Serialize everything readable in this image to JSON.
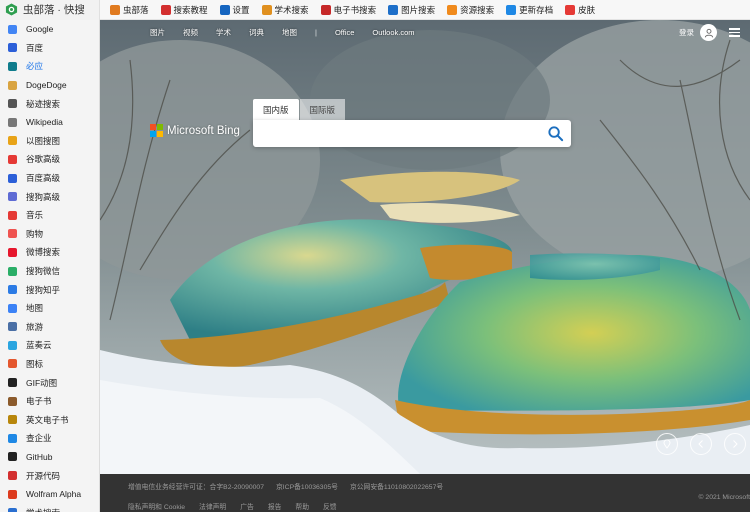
{
  "app": {
    "title": "虫部落 · 快搜"
  },
  "toolbar": [
    {
      "label": "虫部落",
      "icon": "tools-icon",
      "color": "#e07a1f"
    },
    {
      "label": "搜索教程",
      "icon": "tutorial-icon",
      "color": "#d32f2f"
    },
    {
      "label": "设置",
      "icon": "gear-icon",
      "color": "#1565c0"
    },
    {
      "label": "学术搜索",
      "icon": "scholar-icon",
      "color": "#e0901f"
    },
    {
      "label": "电子书搜索",
      "icon": "ebook-icon",
      "color": "#c62828"
    },
    {
      "label": "图片搜索",
      "icon": "image-icon",
      "color": "#1e6fc9"
    },
    {
      "label": "资源搜索",
      "icon": "cloud-icon",
      "color": "#f08a1c"
    },
    {
      "label": "更新存档",
      "icon": "refresh-icon",
      "color": "#1e88e5"
    },
    {
      "label": "皮肤",
      "icon": "brush-icon",
      "color": "#e53935"
    }
  ],
  "sidebar": {
    "items": [
      {
        "label": "Google",
        "color": "#4285f4",
        "active": false
      },
      {
        "label": "百度",
        "color": "#2c5fd8",
        "active": false
      },
      {
        "label": "必应",
        "color": "#0f7c8c",
        "active": true
      },
      {
        "label": "DogeDoge",
        "color": "#d9a441",
        "active": false
      },
      {
        "label": "秘迹搜索",
        "color": "#555555",
        "active": false
      },
      {
        "label": "Wikipedia",
        "color": "#777777",
        "active": false
      },
      {
        "label": "以图搜图",
        "color": "#e8a317",
        "active": false
      },
      {
        "label": "谷歌高级",
        "color": "#e53935",
        "active": false
      },
      {
        "label": "百度高级",
        "color": "#2c5fd8",
        "active": false
      },
      {
        "label": "搜狗高级",
        "color": "#5e6bd4",
        "active": false
      },
      {
        "label": "音乐",
        "color": "#e53935",
        "active": false
      },
      {
        "label": "购物",
        "color": "#ef5350",
        "active": false
      },
      {
        "label": "微博搜索",
        "color": "#e6162d",
        "active": false
      },
      {
        "label": "搜狗微信",
        "color": "#2aae67",
        "active": false
      },
      {
        "label": "搜狗知乎",
        "color": "#2c7be5",
        "active": false
      },
      {
        "label": "地图",
        "color": "#3b82f6",
        "active": false
      },
      {
        "label": "旅游",
        "color": "#4a6fa5",
        "active": false
      },
      {
        "label": "蓝奏云",
        "color": "#2aa5e0",
        "active": false
      },
      {
        "label": "图标",
        "color": "#e4572e",
        "active": false
      },
      {
        "label": "GIF动图",
        "color": "#222222",
        "active": false
      },
      {
        "label": "电子书",
        "color": "#8b5a2b",
        "active": false
      },
      {
        "label": "英文电子书",
        "color": "#b8860b",
        "active": false
      },
      {
        "label": "查企业",
        "color": "#1e88e5",
        "active": false
      },
      {
        "label": "GitHub",
        "color": "#222222",
        "active": false
      },
      {
        "label": "开源代码",
        "color": "#d32f2f",
        "active": false
      },
      {
        "label": "Wolfram Alpha",
        "color": "#dd3b1e",
        "active": false
      },
      {
        "label": "学术搜索",
        "color": "#2a6fd0",
        "active": false
      }
    ]
  },
  "bing": {
    "nav": [
      "图片",
      "视频",
      "学术",
      "词典",
      "地图"
    ],
    "nav_separator": "|",
    "nav_extra": [
      "Office",
      "Outlook.com"
    ],
    "login_label": "登录",
    "logo_text": "Microsoft Bing",
    "tab_domestic": "国内版",
    "tab_international": "国际版",
    "search_value": "",
    "footer_line1": [
      "增值电信业务经营许可证：合字B2-20090007",
      "京ICP备10036305号",
      "京公网安备11010802022657号"
    ],
    "footer_line2": [
      "隐私声明和 Cookie",
      "法律声明",
      "广告",
      "报告",
      "帮助",
      "反馈"
    ],
    "copyright": "© 2021 Microsoft"
  }
}
